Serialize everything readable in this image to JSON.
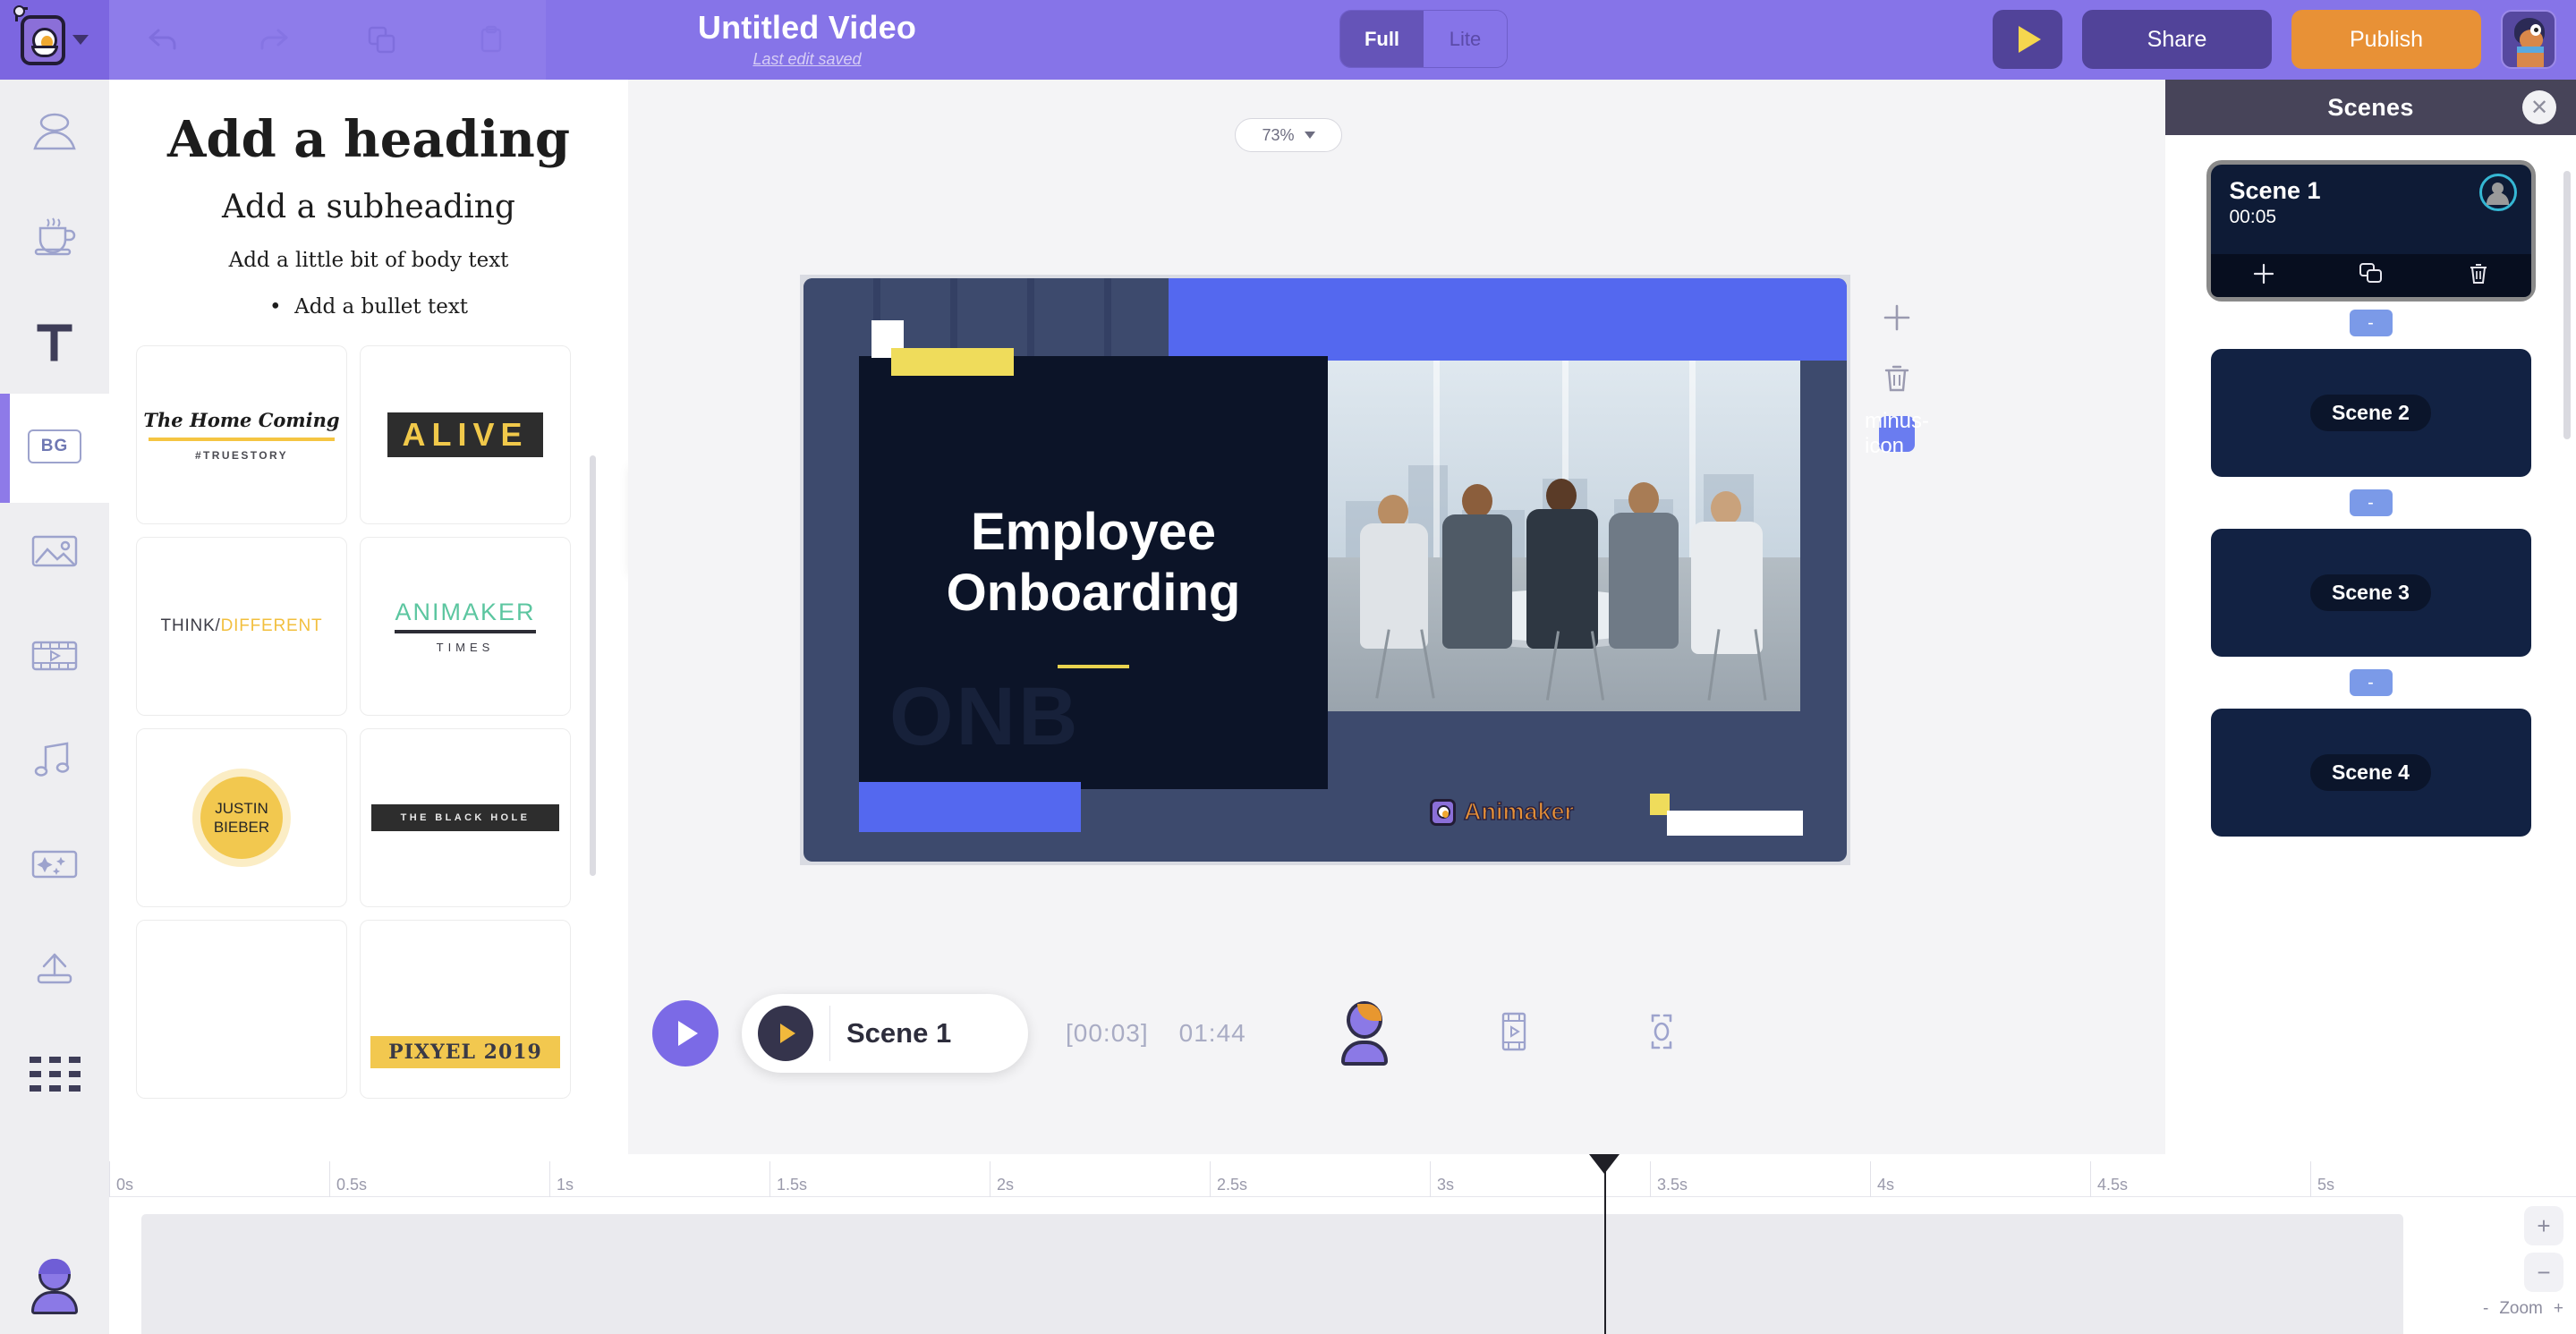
{
  "topbar": {
    "logo_icon": "animaker-mascot-logo",
    "menu_chevron_icon": "chevron-down-icon",
    "undo_icon": "undo-icon",
    "redo_icon": "redo-icon",
    "copy_icon": "copy-icon",
    "paste_icon": "paste-icon",
    "title": "Untitled Video",
    "save_status": "Last edit saved",
    "mode_full": "Full",
    "mode_lite": "Lite",
    "preview_icon": "play-icon",
    "share_label": "Share",
    "publish_label": "Publish",
    "account_avatar_icon": "dog-avatar-icon"
  },
  "rail": {
    "items": [
      {
        "name": "character",
        "icon": "character-icon"
      },
      {
        "name": "props",
        "icon": "coffee-cup-icon"
      },
      {
        "name": "text",
        "icon": "text-T-icon",
        "selected": true
      },
      {
        "name": "background",
        "icon": "bg-icon",
        "label": "BG"
      },
      {
        "name": "image",
        "icon": "image-icon"
      },
      {
        "name": "video",
        "icon": "video-film-icon"
      },
      {
        "name": "music",
        "icon": "music-note-icon"
      },
      {
        "name": "effects",
        "icon": "sparkle-effects-icon"
      },
      {
        "name": "upload",
        "icon": "upload-icon"
      },
      {
        "name": "apps",
        "icon": "grid-apps-icon"
      }
    ],
    "user_avatar_icon": "user-avatar-icon"
  },
  "text_panel": {
    "presets": {
      "heading": "Add a heading",
      "subheading": "Add a subheading",
      "body": "Add a little bit of body text",
      "bullet": "Add a bullet text"
    },
    "cards": [
      {
        "id": "home-coming",
        "title": "The Home Coming",
        "tag": "#TRUESTORY"
      },
      {
        "id": "alive",
        "title": "ALIVE"
      },
      {
        "id": "think-different",
        "part_a": "THINK/",
        "part_b": "DIFFERENT"
      },
      {
        "id": "animaker-times",
        "title": "ANIMAKER",
        "sub": "TIMES"
      },
      {
        "id": "justin-bieber",
        "line1": "JUSTIN",
        "line2": "BIEBER"
      },
      {
        "id": "the-black-hole",
        "title": "THE BLACK HOLE"
      },
      {
        "id": "pixyel",
        "title": "PIXYEL  2019"
      }
    ],
    "collapse_icon": "chevron-left-icon"
  },
  "stage": {
    "zoom_level": "73%",
    "zoom_chevron_icon": "chevron-down-icon",
    "add_icon": "plus-icon",
    "delete_icon": "trash-icon",
    "minus_icon": "minus-icon",
    "canvas": {
      "title_line1": "Employee",
      "title_line2": "Onboarding",
      "ghost_text": "ONB",
      "watermark": "Animaker"
    }
  },
  "player": {
    "play_icon": "play-icon",
    "scene_play_icon": "play-icon",
    "scene_label": "Scene 1",
    "current_time": "[00:03]",
    "total_time": "01:44",
    "character_icon": "character-icon",
    "video_icon": "video-film-icon",
    "focus_icon": "focus-frame-icon"
  },
  "scenes": {
    "title": "Scenes",
    "close_icon": "close-icon",
    "items": [
      {
        "name": "Scene 1",
        "duration": "00:05",
        "selected": true,
        "avatar_icon": "character-avatar-icon",
        "add_icon": "plus-icon",
        "duplicate_icon": "copy-icon",
        "delete_icon": "trash-icon"
      },
      {
        "name": "Scene 2",
        "selected": false
      },
      {
        "name": "Scene 3",
        "selected": false
      },
      {
        "name": "Scene 4",
        "selected": false
      }
    ],
    "transition_label": "-"
  },
  "timeline": {
    "ticks": [
      "0s",
      "0.5s",
      "1s",
      "1.5s",
      "2s",
      "2.5s",
      "3s",
      "3.5s",
      "4s",
      "4.5s",
      "5s"
    ],
    "zoom_in_icon": "plus-icon",
    "zoom_out_icon": "minus-icon",
    "zoom_minus": "-",
    "zoom_label": "Zoom",
    "zoom_plus": "+"
  }
}
